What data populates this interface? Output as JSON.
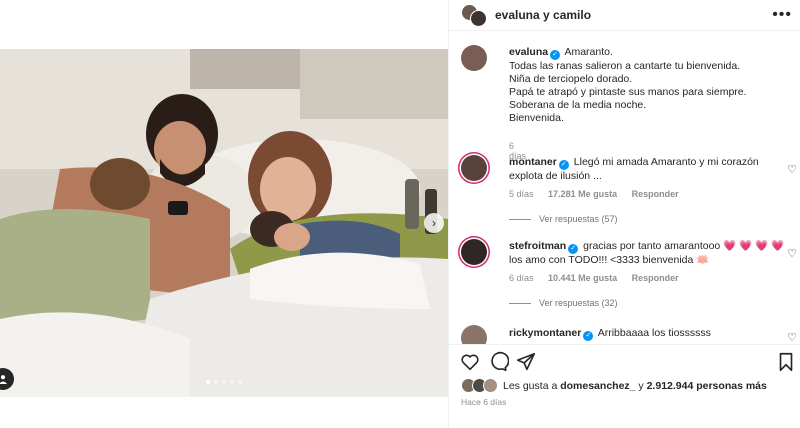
{
  "post": {
    "header_username": "evaluna y camilo",
    "author": "evaluna",
    "caption_lines": [
      "Amaranto.",
      "Todas las ranas salieron a cantarte tu bienvenida.",
      "Niña de terciopelo dorado.",
      "Papá te atrapó y pintaste sus manos para siempre.",
      "Soberana de la media noche.",
      "Bienvenida."
    ],
    "caption_time": "6 días",
    "carousel_count": 5,
    "carousel_active": 0
  },
  "comments": [
    {
      "username": "montaner",
      "text": "Llegó mi amada Amaranto y mi corazón explota de ilusión ...",
      "time": "5 días",
      "likes": "17.281 Me gusta",
      "reply_label": "Responder",
      "view_replies": "Ver respuestas (57)"
    },
    {
      "username": "stefroitman",
      "text": "gracias por tanto amarantooo 💗 💗 💗 💗 los amo con TODO!!! <3333 bienvenida 🪷",
      "time": "6 días",
      "likes": "10.441 Me gusta",
      "reply_label": "Responder",
      "view_replies": "Ver respuestas (32)"
    },
    {
      "username": "rickymontaner",
      "text": "Arribbaaaa los tiossssss"
    }
  ],
  "likes": {
    "prefix": "Les gusta a",
    "user": "domesanchez_",
    "connector": "y",
    "count": "2.912.944 personas más"
  },
  "date_label": "Hace 6 días",
  "icons": {
    "more": "more-options-icon",
    "heart": "heart-icon",
    "comment": "comment-icon",
    "share": "share-icon",
    "save": "bookmark-icon",
    "verified": "verified-badge-icon",
    "next": "chevron-right-icon",
    "tag": "user-tag-icon"
  },
  "colors": {
    "verified_blue": "#0095f6",
    "story_ring": "#d62976",
    "muted_text": "#8e8e8e"
  }
}
